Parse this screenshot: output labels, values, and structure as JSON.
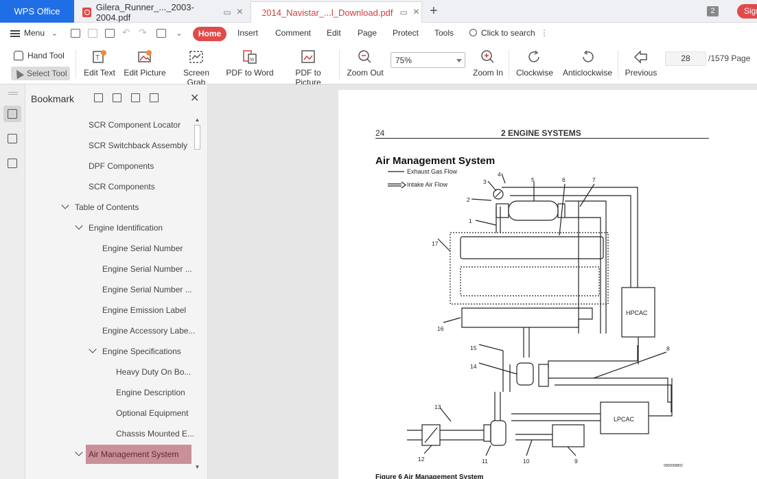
{
  "tabs": {
    "app": "WPS Office",
    "doc1": "Gilera_Runner_..._2003-2004.pdf",
    "doc2": "2014_Navistar_...l_Download.pdf",
    "count": "2",
    "sign": "Sign"
  },
  "menu": {
    "menu_label": "Menu",
    "home": "Home",
    "insert": "Insert",
    "comment": "Comment",
    "edit": "Edit",
    "page": "Page",
    "protect": "Protect",
    "tools": "Tools",
    "search": "Click to search"
  },
  "toolbar": {
    "hand_tool": "Hand Tool",
    "select_tool": "Select Tool",
    "edit_text": "Edit Text",
    "edit_picture": "Edit Picture",
    "screen_grab": "Screen Grab",
    "pdf_to_word": "PDF to Word",
    "pdf_to_picture": "PDF to Picture",
    "zoom_out": "Zoom Out",
    "zoom_value": "75%",
    "zoom_in": "Zoom In",
    "clockwise": "Clockwise",
    "anticlockwise": "Anticlockwise",
    "previous": "Previous",
    "page_current": "28",
    "page_total": "/1579 Page"
  },
  "bookmark": {
    "title": "Bookmark",
    "items": [
      {
        "label": "SCR Component Locator"
      },
      {
        "label": "SCR Switchback Assembly"
      },
      {
        "label": "DPF Components"
      },
      {
        "label": "SCR Components"
      },
      {
        "label": "Table of Contents"
      },
      {
        "label": "Engine Identification"
      },
      {
        "label": "Engine Serial Number"
      },
      {
        "label": "Engine Serial Number ..."
      },
      {
        "label": "Engine Serial Number ..."
      },
      {
        "label": "Engine Emission Label"
      },
      {
        "label": "Engine Accessory Labe..."
      },
      {
        "label": "Engine Specifications"
      },
      {
        "label": "Heavy Duty On Bo..."
      },
      {
        "label": "Engine Description"
      },
      {
        "label": "Optional Equipment"
      },
      {
        "label": "Chassis Mounted E..."
      },
      {
        "label": "Air Management System"
      }
    ]
  },
  "document": {
    "page_number": "24",
    "header": "2  ENGINE SYSTEMS",
    "section_title": "Air Management System",
    "legend_exhaust": "Exhaust Gas Flow",
    "legend_intake": "Intake Air Flow",
    "hpcac": "HPCAC",
    "lpcac": "LPCAC",
    "drawing_id": "0000058802",
    "caption": "Figure 6    Air Management System",
    "callouts": [
      "1",
      "2",
      "3",
      "4",
      "5",
      "6",
      "7",
      "8",
      "9",
      "10",
      "11",
      "12",
      "13",
      "14",
      "15",
      "16",
      "17"
    ]
  }
}
